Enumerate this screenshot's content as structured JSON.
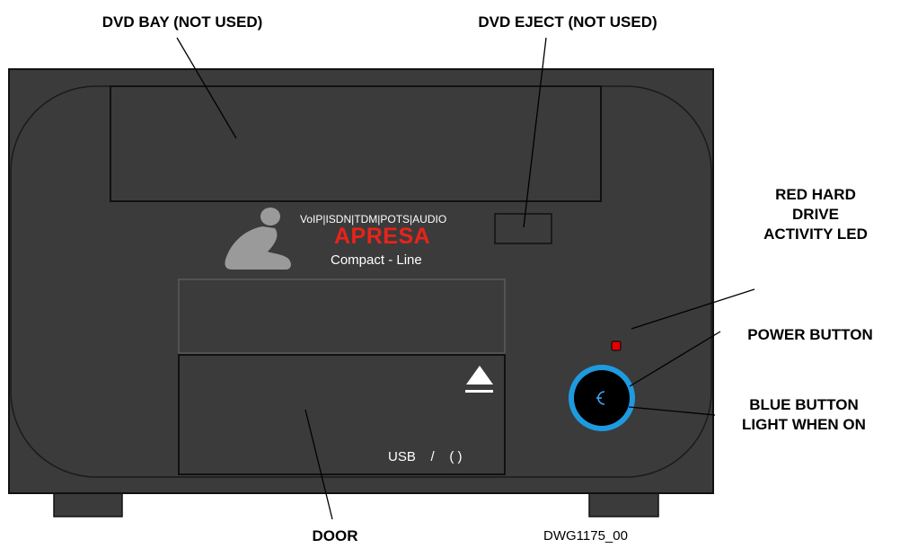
{
  "callouts": {
    "dvd_bay": "DVD BAY  (NOT USED)",
    "dvd_eject": "DVD EJECT  (NOT USED)",
    "red_led": [
      "RED HARD",
      "DRIVE",
      "ACTIVITY LED"
    ],
    "power_button": "POWER BUTTON",
    "blue_light": [
      "BLUE BUTTON",
      "LIGHT WHEN ON"
    ],
    "door": "DOOR"
  },
  "drawing_number": "DWG1175_00",
  "branding": {
    "protocols": "VoIP|ISDN|TDM|POTS|AUDIO",
    "product": "APRESA",
    "line": "Compact - Line"
  },
  "usb_label": "USB    /    ( )",
  "colors": {
    "chassis": "#3b3b3b",
    "chassis_outline": "#111111",
    "brand_red": "#e8231b",
    "led_red": "#e50000",
    "button_ring": "#1e9be0",
    "power_symbol": "#3aa7f0",
    "logo_grey": "#9a9a9a",
    "label_text": "#ffffff"
  },
  "icons": [
    "kneeling-figure-logo-icon",
    "eject-icon",
    "power-icon"
  ]
}
